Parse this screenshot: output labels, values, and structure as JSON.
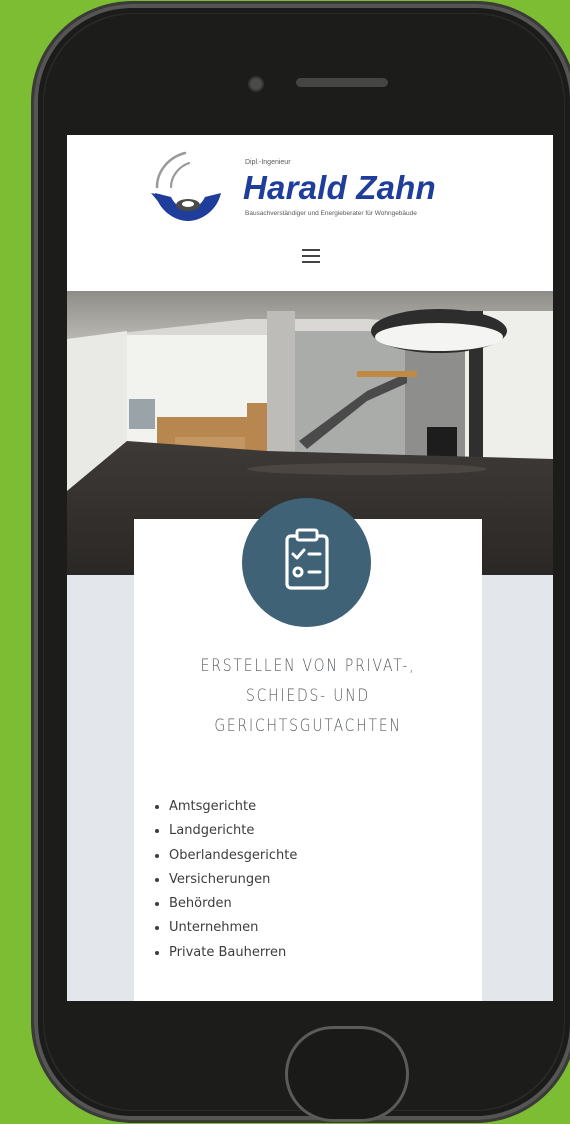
{
  "logo": {
    "small_title": "Dipl.-Ingenieur",
    "name": "Harald Zahn",
    "subtitle": "Bausachverständiger und Energieberater für Wohngebäude"
  },
  "nav": {
    "menu_icon": "hamburger-menu-icon"
  },
  "hero": {
    "image_subject": "interior-photo"
  },
  "card": {
    "icon": "clipboard-checklist-icon",
    "heading_line1": "ERSTELLEN VON PRIVAT-,",
    "heading_line2": "SCHIEDS- UND",
    "heading_line3": "GERICHTSGUTACHTEN",
    "items": [
      "Amtsgerichte",
      "Landgerichte",
      "Oberlandesgerichte",
      "Versicherungen",
      "Behörden",
      "Unternehmen",
      "Private Bauherren"
    ]
  },
  "colors": {
    "background": "#7dbd33",
    "brand_blue": "#1f3d9a",
    "icon_circle": "#3f6276",
    "section_grey": "#e3e6eb"
  }
}
